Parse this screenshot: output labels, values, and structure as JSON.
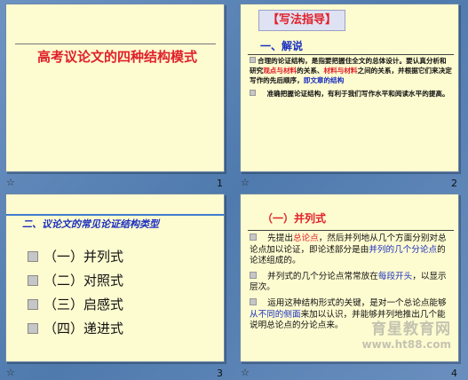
{
  "slides": [
    {
      "number": "1",
      "title": "高考议论文的四种结构模式"
    },
    {
      "number": "2",
      "header": "【写法指导】",
      "section": "一、解说",
      "para1": {
        "a": "合理的论证结构，是指要把握住全文的总体设计。要认真分析和研究",
        "b": "观点与材料",
        "c": "的关系、",
        "d": "材料与材料",
        "e": "之间的关系，并根据它们来决定写作的先后顺序，",
        "f": "即文章的结构"
      },
      "para2": "准确把握论证结构，有利于我们写作水平和阅读水平的提高。"
    },
    {
      "number": "3",
      "header": "二、议论文的常见论证结构类型",
      "items": [
        "（一）并列式",
        "（二）对照式",
        "（三）启感式",
        "（四）递进式"
      ]
    },
    {
      "number": "4",
      "header": "（一）并列式",
      "p1": {
        "a": "先提出",
        "b": "总论点",
        "c": "，然后并列地从几个方面分别对总论点加以论证，即论述部分是由",
        "d": "并列的几个分论点",
        "e": "的论述组成的。"
      },
      "p2": {
        "a": "并列式的几个分论点常常放在",
        "b": "每段开头",
        "c": "，以显示层次。"
      },
      "p3": {
        "a": "运用这种结构形式的关键，是对一个总论点能够",
        "b": "从不同的侧面",
        "c": "来加以认识，并能够并列地推出几个能说明总论点的分论点来。"
      },
      "watermark": {
        "line1": "育星教育网",
        "line2": "www.ht88.com"
      }
    }
  ],
  "star_glyph": "☆"
}
